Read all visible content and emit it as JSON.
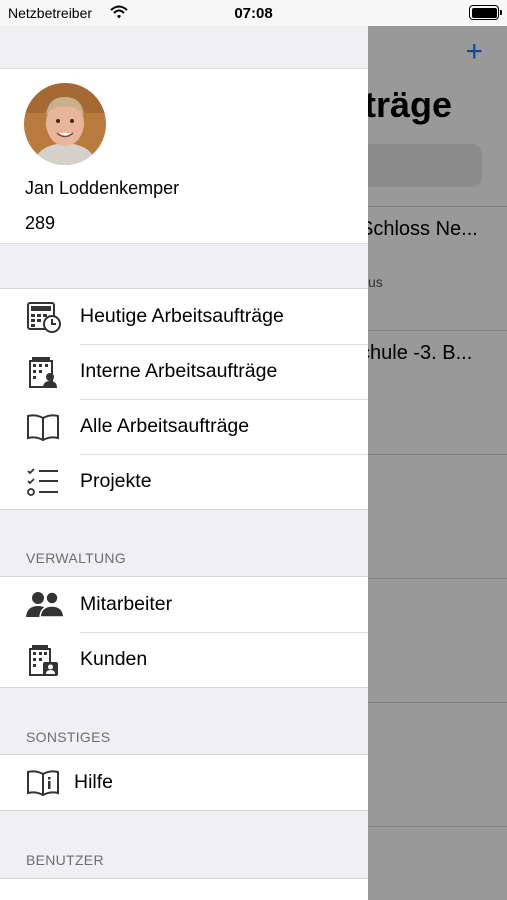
{
  "status_bar": {
    "carrier": "Netzbetreiber",
    "time": "07:08"
  },
  "background": {
    "title_fragment": "fträge",
    "rows": [
      {
        "title": "Schloss Ne...",
        "subtitle": "us"
      },
      {
        "title": "chule -3. B...",
        "subtitle": ""
      }
    ]
  },
  "drawer": {
    "profile": {
      "name": "Jan Loddenkemper",
      "number": "289"
    },
    "main_items": [
      {
        "label": "Heutige Arbeitsaufträge",
        "icon": "calculator-clock-icon"
      },
      {
        "label": "Interne Arbeitsaufträge",
        "icon": "building-person-icon"
      },
      {
        "label": "Alle Arbeitsaufträge",
        "icon": "book-icon"
      },
      {
        "label": "Projekte",
        "icon": "checklist-icon"
      }
    ],
    "verwaltung": {
      "header": "VERWALTUNG",
      "items": [
        {
          "label": "Mitarbeiter",
          "icon": "people-icon"
        },
        {
          "label": "Kunden",
          "icon": "building-contact-icon"
        }
      ]
    },
    "sonstiges": {
      "header": "SONSTIGES",
      "items": [
        {
          "label": "Hilfe",
          "icon": "help-book-icon"
        }
      ]
    },
    "benutzer": {
      "header": "BENUTZER"
    }
  },
  "colors": {
    "accent": "#1f7bff",
    "drawer_background": "#efeff4",
    "section_header": "#6d6d72"
  }
}
